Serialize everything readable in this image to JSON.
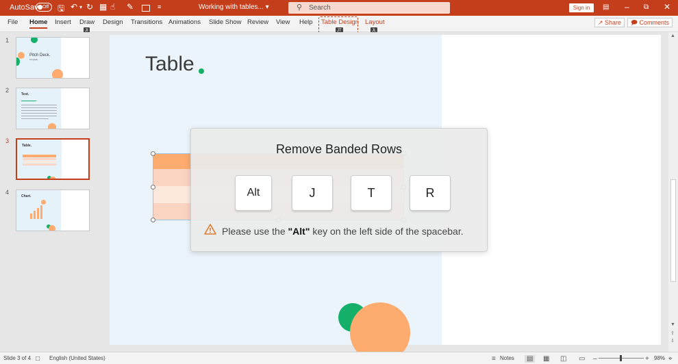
{
  "titlebar": {
    "autosave_label": "AutoSave",
    "autosave_state": "Off",
    "doc_title": "Working with tables...",
    "search_placeholder": "Search",
    "signin_label": "Sign in"
  },
  "ribbon": {
    "tabs": [
      "File",
      "Home",
      "Insert",
      "Draw",
      "Design",
      "Transitions",
      "Animations",
      "Slide Show",
      "Review",
      "View",
      "Help",
      "Table Design",
      "Layout"
    ],
    "active_tab": "Home",
    "keytips": {
      "draw": "JI",
      "table_design": "JT",
      "layout": "JL"
    },
    "share_label": "Share",
    "comments_label": "Comments"
  },
  "thumbnails": [
    {
      "number": "1",
      "title": "Pitch Deck.",
      "subtitle": "Template"
    },
    {
      "number": "2",
      "title": "Text."
    },
    {
      "number": "3",
      "title": "Table."
    },
    {
      "number": "4",
      "title": "Chart."
    }
  ],
  "slide": {
    "title": "Table",
    "accent_color": "#14b06a",
    "orange_color": "#fdab6e"
  },
  "popup": {
    "title": "Remove Banded Rows",
    "keys": [
      "Alt",
      "J",
      "T",
      "R"
    ],
    "warning_prefix": "Please use the ",
    "warning_key": "\"Alt\"",
    "warning_suffix": " key on the left side of the spacebar."
  },
  "statusbar": {
    "slide_info": "Slide 3 of 4",
    "language": "English (United States)",
    "notes_label": "Notes",
    "zoom": "98%"
  }
}
